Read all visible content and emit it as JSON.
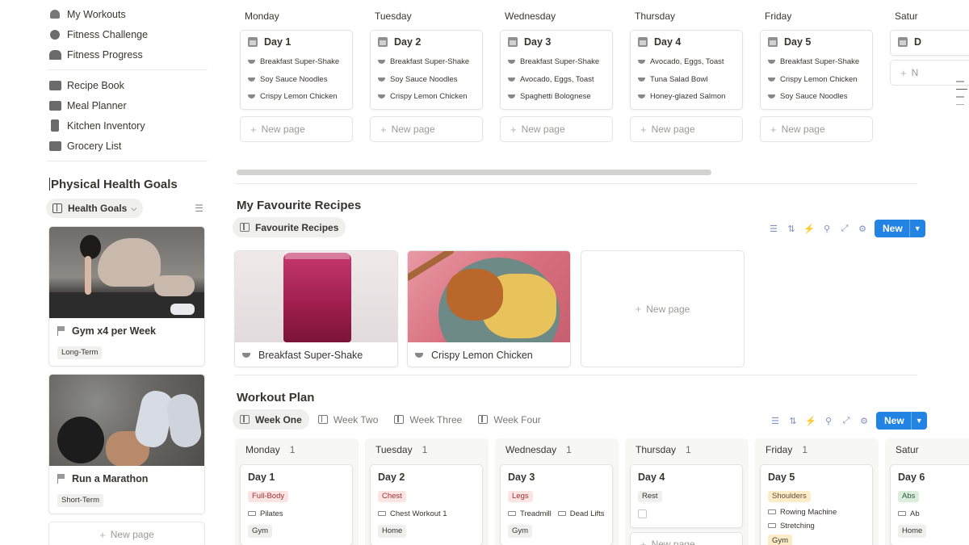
{
  "sidebar": {
    "nav_group1": [
      {
        "label": "My Workouts",
        "icon": "heart-icon"
      },
      {
        "label": "Fitness Challenge",
        "icon": "challenge-icon"
      },
      {
        "label": "Fitness Progress",
        "icon": "people-icon"
      }
    ],
    "nav_group2": [
      {
        "label": "Recipe Book",
        "icon": "book-icon"
      },
      {
        "label": "Meal Planner",
        "icon": "map-icon"
      },
      {
        "label": "Kitchen Inventory",
        "icon": "fridge-icon"
      },
      {
        "label": "Grocery List",
        "icon": "groceries-icon"
      }
    ],
    "goals_title": "Physical Health Goals",
    "goals_view": "Health Goals",
    "goals": [
      {
        "name": "Gym x4 per Week",
        "tag": "Long-Term"
      },
      {
        "name": "Run a Marathon",
        "tag": "Short-Term"
      }
    ],
    "new_page": "New page"
  },
  "meal_board": {
    "columns": [
      {
        "day": "Monday",
        "card": "Day 1",
        "items": [
          "Breakfast Super-Shake",
          "Soy Sauce Noodles",
          "Crispy Lemon Chicken"
        ]
      },
      {
        "day": "Tuesday",
        "card": "Day 2",
        "items": [
          "Breakfast Super-Shake",
          "Soy Sauce Noodles",
          "Crispy Lemon Chicken"
        ]
      },
      {
        "day": "Wednesday",
        "card": "Day 3",
        "items": [
          "Breakfast Super-Shake",
          "Avocado, Eggs, Toast",
          "Spaghetti Bolognese"
        ]
      },
      {
        "day": "Thursday",
        "card": "Day 4",
        "items": [
          "Avocado, Eggs, Toast",
          "Tuna Salad Bowl",
          "Honey-glazed Salmon"
        ]
      },
      {
        "day": "Friday",
        "card": "Day 5",
        "items": [
          "Breakfast Super-Shake",
          "Crispy Lemon Chicken",
          "Soy Sauce Noodles"
        ]
      },
      {
        "day": "Satur",
        "card": "D",
        "items": []
      }
    ],
    "new_page": "New page",
    "new_page_short": "N"
  },
  "recipes": {
    "title": "My Favourite Recipes",
    "view": "Favourite Recipes",
    "cards": [
      {
        "name": "Breakfast Super-Shake"
      },
      {
        "name": "Crispy Lemon Chicken"
      }
    ],
    "new_page": "New page",
    "new_label": "New"
  },
  "workout": {
    "title": "Workout Plan",
    "tabs": [
      "Week One",
      "Week Two",
      "Week Three",
      "Week Four"
    ],
    "active_tab": "Week One",
    "new_label": "New",
    "columns": [
      {
        "day": "Monday",
        "count": "1",
        "card": "Day 1",
        "tag": "Full-Body",
        "tag_color": "#fbe4e4",
        "tag_text": "#9f2f2d",
        "exercises": [
          "Pilates"
        ],
        "location": "Gym"
      },
      {
        "day": "Tuesday",
        "count": "1",
        "card": "Day 2",
        "tag": "Chest",
        "tag_color": "#fbe4e4",
        "tag_text": "#9f2f2d",
        "exercises": [
          "Chest Workout 1"
        ],
        "location": "Home"
      },
      {
        "day": "Wednesday",
        "count": "1",
        "card": "Day 3",
        "tag": "Legs",
        "tag_color": "#fbe4e4",
        "tag_text": "#9f2f2d",
        "exercises": [
          "Treadmill",
          "Dead Lifts"
        ],
        "location": "Gym"
      },
      {
        "day": "Thursday",
        "count": "1",
        "card": "Day 4",
        "tag": "Rest",
        "tag_color": "#efefed",
        "tag_text": "#37352f",
        "exercises": [],
        "location": ""
      },
      {
        "day": "Friday",
        "count": "1",
        "card": "Day 5",
        "tag": "Shoulders",
        "tag_color": "#fdecc8",
        "tag_text": "#64473a",
        "exercises": [
          "Rowing Machine",
          "Stretching"
        ],
        "location": "Gym"
      },
      {
        "day": "Satur",
        "count": "",
        "card": "Day 6",
        "tag": "Abs",
        "tag_color": "#dbeddb",
        "tag_text": "#2b593f",
        "exercises": [
          "Ab"
        ],
        "location": "Home"
      }
    ],
    "new_page": "New page"
  },
  "colors": {
    "accent": "#2383e2",
    "text": "#37352f",
    "muted": "#9b9a97"
  }
}
